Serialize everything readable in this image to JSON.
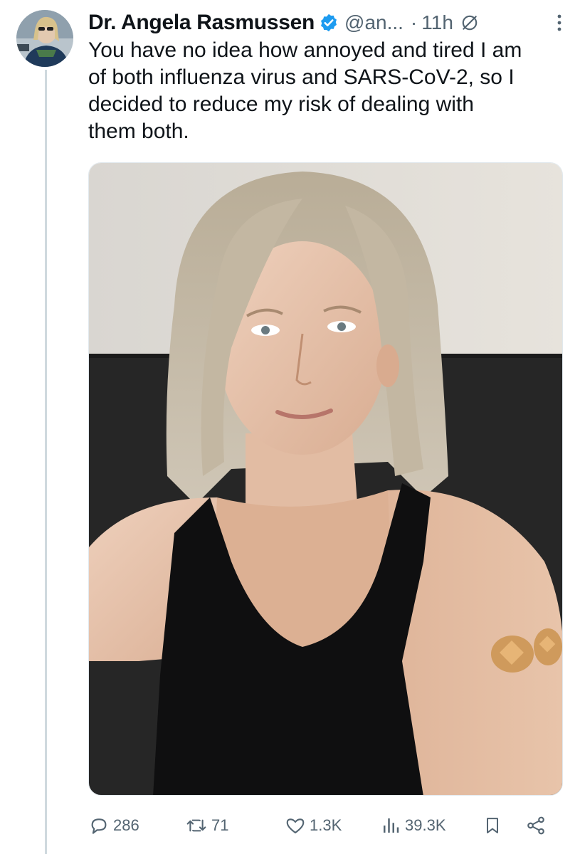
{
  "author": {
    "display_name": "Dr. Angela Rasmussen",
    "handle": "@an...",
    "verified": true,
    "avatar_icon": "profile-photo"
  },
  "meta": {
    "separator": "·",
    "time": "11h"
  },
  "tweet": {
    "text": "You have no idea how annoyed and tired I am\nof both influenza virus and SARS-CoV-2, so I\ndecided to reduce my risk of dealing with\nthem both."
  },
  "media": {
    "type": "photo"
  },
  "actions": {
    "replies": "286",
    "retweets": "71",
    "likes": "1.3K",
    "views": "39.3K"
  },
  "colors": {
    "text_primary": "#0f1419",
    "text_secondary": "#536471",
    "verified_blue": "#1d9bf0",
    "thread_line": "#cfd9de"
  }
}
